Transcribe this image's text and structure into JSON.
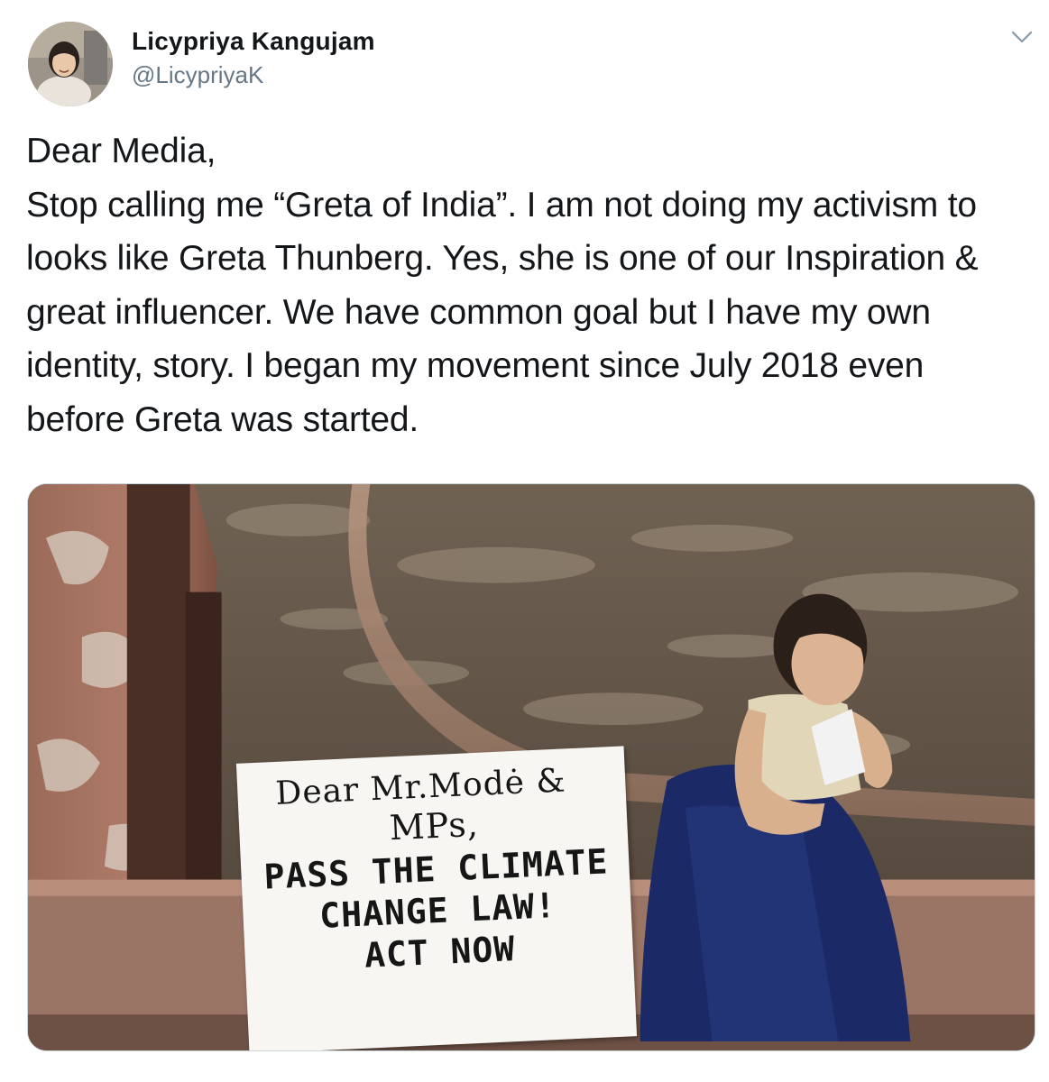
{
  "author": {
    "display_name": "Licypriya Kangujam",
    "handle": "@LicypriyaK",
    "avatar_icon": "profile-photo"
  },
  "menu": {
    "icon": "chevron-down-icon"
  },
  "tweet": {
    "text": "Dear Media,\nStop calling me “Greta of India”. I am not doing my activism to looks like Greta Thunberg. Yes, she is one of our Inspiration & great influencer. We have common goal but I have my own identity, story. I began my movement since July 2018 even before Greta was started."
  },
  "media": {
    "sign_lines": [
      "Dear Mr.Modė &",
      "MPs,",
      "PASS THE CLIMATE",
      "CHANGE LAW!",
      "ACT NOW"
    ]
  },
  "colors": {
    "text_primary": "#14171a",
    "text_secondary": "#657786",
    "border": "#ccd6dd"
  }
}
